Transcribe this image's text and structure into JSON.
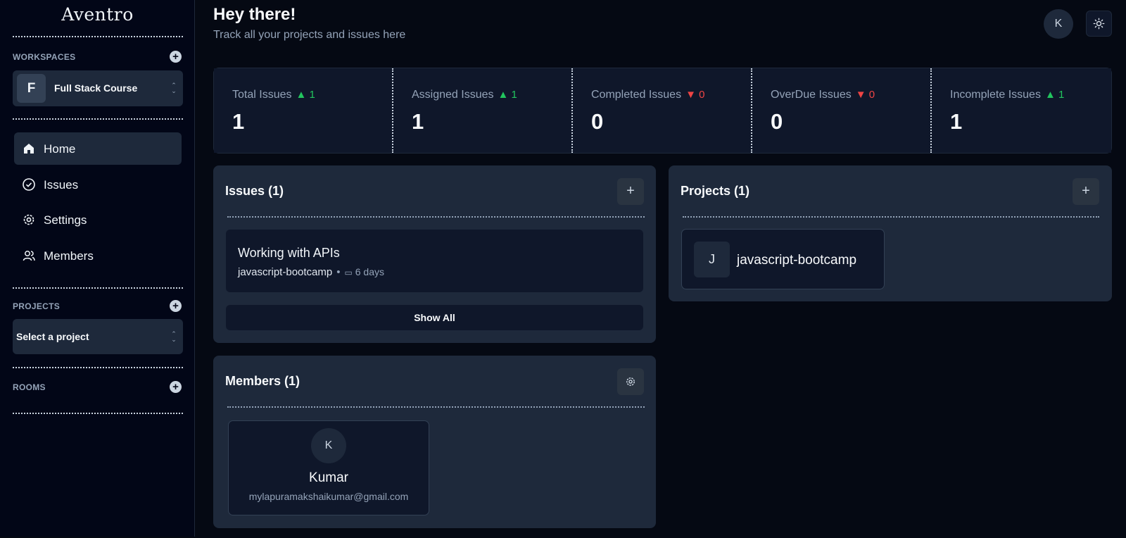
{
  "app": {
    "name": "Aventro"
  },
  "sidebar": {
    "workspaces_label": "WORKSPACES",
    "workspace": {
      "initial": "F",
      "name": "Full Stack Course"
    },
    "nav": [
      {
        "label": "Home",
        "icon": "home-icon",
        "active": true
      },
      {
        "label": "Issues",
        "icon": "check-circle-icon"
      },
      {
        "label": "Settings",
        "icon": "gear-icon"
      },
      {
        "label": "Members",
        "icon": "users-icon"
      }
    ],
    "projects_label": "PROJECTS",
    "project_select_placeholder": "Select a project",
    "rooms_label": "ROOMS"
  },
  "header": {
    "greeting": "Hey there!",
    "subtitle": "Track all your projects and issues here",
    "user_initial": "K"
  },
  "stats": [
    {
      "title": "Total Issues",
      "delta": "1",
      "trend": "up",
      "value": "1"
    },
    {
      "title": "Assigned Issues",
      "delta": "1",
      "trend": "up",
      "value": "1"
    },
    {
      "title": "Completed Issues",
      "delta": "0",
      "trend": "down",
      "value": "0"
    },
    {
      "title": "OverDue Issues",
      "delta": "0",
      "trend": "down",
      "value": "0"
    },
    {
      "title": "Incomplete Issues",
      "delta": "1",
      "trend": "up",
      "value": "1"
    }
  ],
  "issues_card": {
    "title": "Issues (1)",
    "items": [
      {
        "title": "Working with APIs",
        "project": "javascript-bootcamp",
        "due": "6 days"
      }
    ],
    "show_all": "Show All"
  },
  "projects_card": {
    "title": "Projects (1)",
    "items": [
      {
        "initial": "J",
        "name": "javascript-bootcamp"
      }
    ]
  },
  "members_card": {
    "title": "Members (1)",
    "items": [
      {
        "initial": "K",
        "name": "Kumar",
        "email": "mylapuramakshaikumar@gmail.com"
      }
    ]
  },
  "colors": {
    "up": "#22c55e",
    "down": "#ef4444",
    "background": "#050913",
    "card": "#1e293b"
  }
}
